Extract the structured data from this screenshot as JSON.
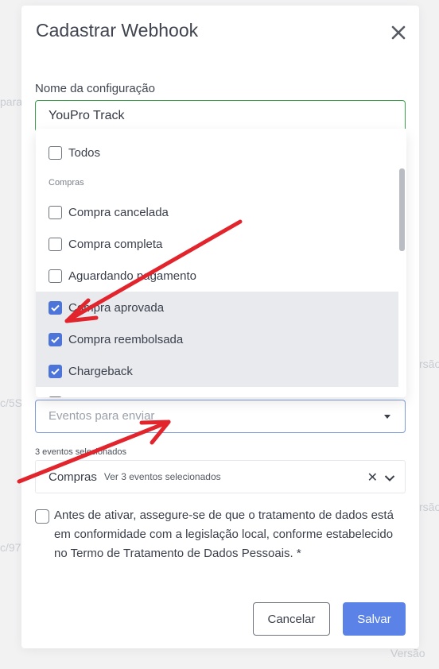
{
  "background": {
    "fragments": [
      "para",
      "c/5S",
      "c/97",
      "rsão",
      "rsão",
      "Versão"
    ]
  },
  "modal": {
    "title": "Cadastrar Webhook",
    "name_label": "Nome da configuração",
    "name_value": "YouPro Track"
  },
  "dropdown": {
    "all_option": "Todos",
    "group_label": "Compras",
    "options": [
      {
        "label": "Compra cancelada",
        "checked": false
      },
      {
        "label": "Compra completa",
        "checked": false
      },
      {
        "label": "Aguardando pagamento",
        "checked": false
      },
      {
        "label": "Compra aprovada",
        "checked": true
      },
      {
        "label": "Compra reembolsada",
        "checked": true
      },
      {
        "label": "Chargeback",
        "checked": true
      }
    ]
  },
  "events_select": {
    "placeholder": "Eventos para enviar"
  },
  "selection": {
    "count_text": "3 eventos selecionados",
    "group_name": "Compras",
    "view_link": "Ver 3 eventos selecionados"
  },
  "consent": {
    "text": "Antes de ativar, assegure-se de que o tratamento de dados está em conformidade com a legislação local, conforme estabelecido no Termo de Tratamento de Dados Pessoais. *"
  },
  "buttons": {
    "cancel": "Cancelar",
    "save": "Salvar"
  },
  "colors": {
    "accent": "#4c74d9",
    "primary_button": "#5b82e6",
    "input_focus": "#3aa14b",
    "annotation_arrow": "#e2252d"
  },
  "icons": {
    "close": "close-icon",
    "caret": "caret-down-icon",
    "clear": "clear-icon",
    "chevron": "chevron-down-icon",
    "check": "check-icon"
  }
}
